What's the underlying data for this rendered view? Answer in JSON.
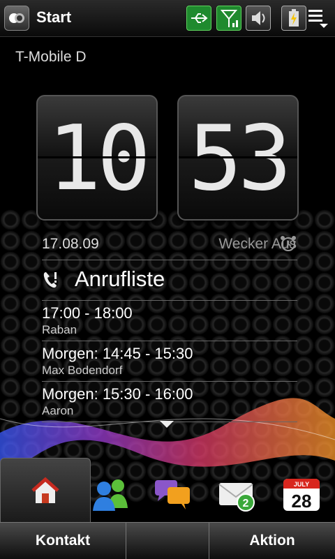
{
  "status": {
    "title": "Start"
  },
  "operator": "T-Mobile D",
  "clock": {
    "hours": "10",
    "minutes": "53"
  },
  "date": "17.08.09",
  "alarm": "Wecker Aus",
  "call_log": {
    "title": "Anrufliste",
    "entries": [
      {
        "time": "17:00 - 18:00",
        "name": "Raban"
      },
      {
        "time": "Morgen: 14:45 - 15:30",
        "name": "Max Bodendorf"
      },
      {
        "time": "Morgen: 15:30 - 16:00",
        "name": "Aaron"
      }
    ]
  },
  "calendar_icon": {
    "month": "JULY",
    "day": "28"
  },
  "mail_badge": "2",
  "softkeys": {
    "left": "Kontakt",
    "right": "Aktion"
  },
  "colors": {
    "accent_green": "#1f8a2e",
    "background": "#000000"
  }
}
